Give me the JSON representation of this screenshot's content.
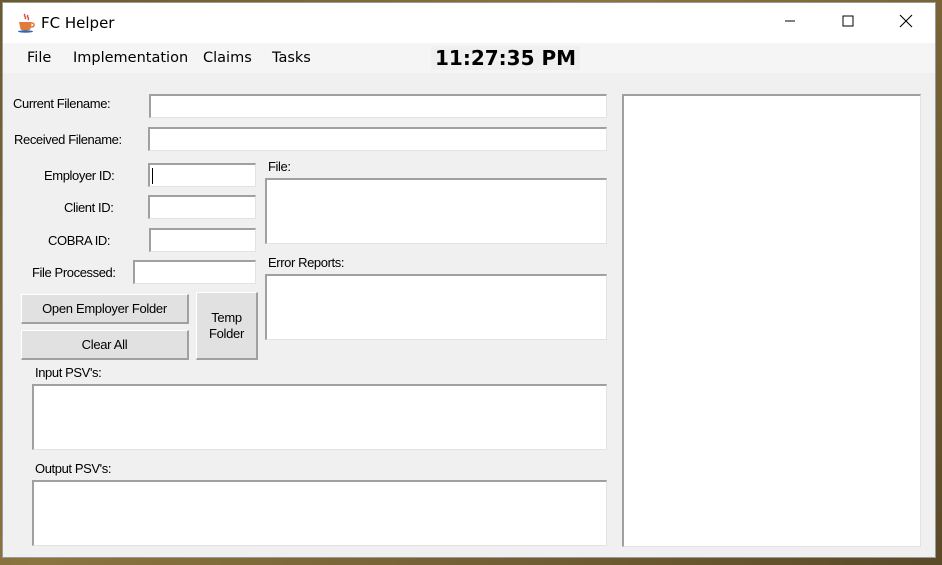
{
  "window": {
    "title": "FC Helper",
    "icon": "java-cup-icon"
  },
  "controls": {
    "minimize": "minimize-icon",
    "maximize": "maximize-icon",
    "close": "close-icon"
  },
  "menu": {
    "file": "File",
    "implementation": "Implementation",
    "claims": "Claims",
    "tasks": "Tasks"
  },
  "clock": "11:27:35 PM",
  "form": {
    "current_filename_label": "Current Filename:",
    "received_filename_label": "Received Filename:",
    "employer_id_label": "Employer ID:",
    "client_id_label": "Client ID:",
    "cobra_id_label": "COBRA ID:",
    "file_processed_label": "File Processed:",
    "file_label": "File:",
    "error_reports_label": "Error Reports:",
    "input_psvs_label": "Input PSV's:",
    "output_psvs_label": "Output PSV's:"
  },
  "values": {
    "current_filename": "",
    "received_filename": "",
    "employer_id": "",
    "client_id": "",
    "cobra_id": "",
    "file_processed": ""
  },
  "buttons": {
    "open_employer_folder": "Open Employer Folder",
    "clear_all": "Clear All",
    "temp_folder_line1": "Temp",
    "temp_folder_line2": "Folder"
  }
}
